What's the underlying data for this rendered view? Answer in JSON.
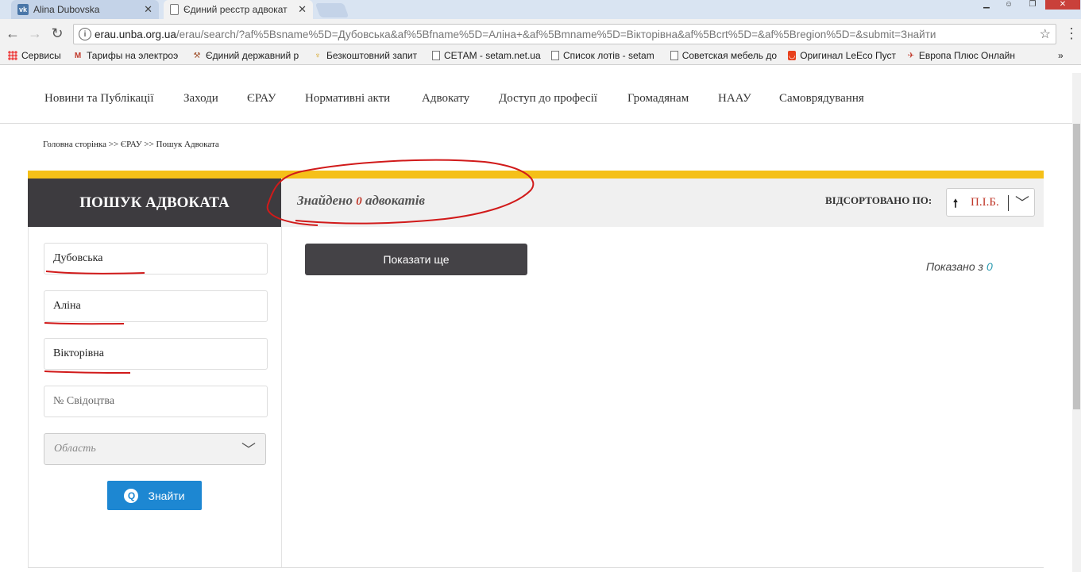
{
  "browser": {
    "tabs": [
      {
        "title": "Alina Dubovska",
        "icon": "vk-icon"
      },
      {
        "title": "Єдиний реєстр адвокат",
        "icon": "page-icon"
      }
    ],
    "address": {
      "host": "erau.unba.org.ua",
      "path": "/erau/search/?af%5Bsname%5D=Дубовська&af%5Bfname%5D=Аліна+&af%5Bmname%5D=Вікторівна&af%5Bcrt%5D=&af%5Bregion%5D=&submit=Знайти"
    },
    "bookmarks": [
      "Сервисы",
      "Тарифы на электроэ",
      "Єдиний державний р",
      "Безкоштовний запит",
      "СЕТАМ - setam.net.ua",
      "Список лотів - setam",
      "Советская мебель до",
      "Оригинал LeEco Пуст",
      "Европа Плюс Онлайн"
    ],
    "more": "»"
  },
  "site": {
    "nav": [
      "Новини та Публікації",
      "Заходи",
      "ЄРАУ",
      "Нормативні акти",
      "Адвокату",
      "Доступ до професії",
      "Громадянам",
      "НААУ",
      "Самоврядування"
    ],
    "breadcrumb": "Головна сторінка >> ЄРАУ >> Пошук Адвоката",
    "search_title": "ПОШУК АДВОКАТА",
    "found": {
      "prefix": "Знайдено",
      "count": "0",
      "suffix": "адвокатів"
    },
    "sort": {
      "label": "ВІДСОРТОВАНО ПО:",
      "value": "П.І.Б."
    },
    "form": {
      "surname": "Дубовська",
      "name": "Аліна",
      "patronymic": "Вікторівна",
      "certificate_placeholder": "№ Свідоцтва",
      "region_placeholder": "Область",
      "submit": "Знайти"
    },
    "show_more": "Показати ще",
    "shown": {
      "prefix": "Показано з",
      "count": "0"
    }
  },
  "colors": {
    "accent_yellow": "#f5c018",
    "dark": "#3d3b3f",
    "blue": "#1d87d2",
    "annotation_red": "#d11a1a"
  }
}
